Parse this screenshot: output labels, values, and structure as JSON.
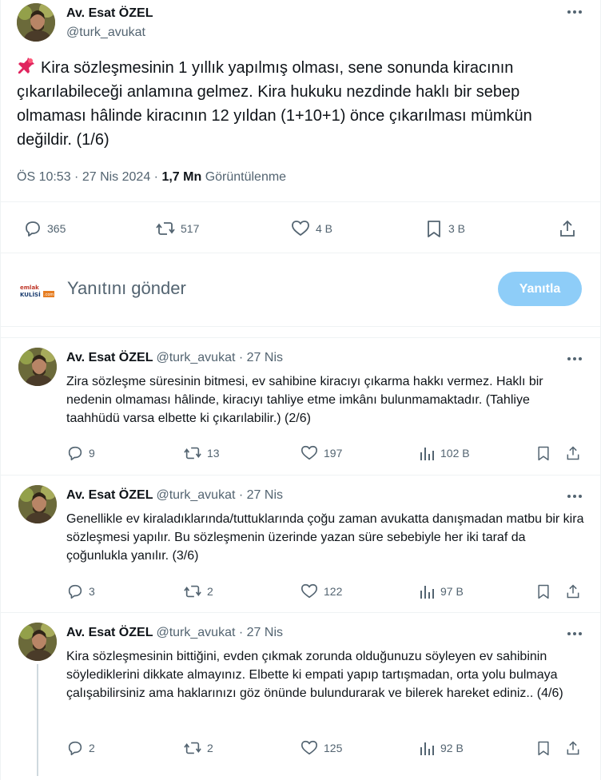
{
  "main": {
    "author_name": "Av. Esat ÖZEL",
    "author_handle": "@turk_avukat",
    "text": "Kira sözleşmesinin 1 yıllık yapılmış olması, sene sonunda kiracının çıkarılabileceği anlamına gelmez. Kira hukuku nezdinde haklı bir sebep olmaması hâlinde kiracının 12 yıldan  (1+10+1) önce çıkarılması mümkün değildir. (1/6)",
    "time": "ÖS 10:53 · 27 Nis 2024 · ",
    "views_count": "1,7 Mn",
    "views_label": "Görüntülenme",
    "actions": {
      "replies": "365",
      "reposts": "517",
      "likes": "4 B",
      "bookmarks": "3 B"
    }
  },
  "reply_box": {
    "logo_line1": "emlak",
    "logo_line2": "KULİSİ",
    "logo_suffix": ".com",
    "placeholder": "Yanıtını gönder",
    "button_label": "Yanıtla"
  },
  "replies": [
    {
      "name": "Av. Esat ÖZEL",
      "handle": "@turk_avukat · 27 Nis",
      "text": "Zira sözleşme süresinin bitmesi, ev sahibine kiracıyı çıkarma hakkı vermez. Haklı bir nedenin olmaması hâlinde, kiracıyı tahliye etme imkânı bulunmamaktadır. (Tahliye taahhüdü varsa elbette ki çıkarılabilir.) (2/6)",
      "replies": "9",
      "reposts": "13",
      "likes": "197",
      "views": "102 B"
    },
    {
      "name": "Av. Esat ÖZEL",
      "handle": "@turk_avukat · 27 Nis",
      "text": "Genellikle ev kiraladıklarında/tuttuklarında çoğu zaman avukatta danışmadan matbu bir kira sözleşmesi yapılır. Bu sözleşmenin üzerinde yazan süre sebebiyle her iki taraf da çoğunlukla yanılır. (3/6)",
      "replies": "3",
      "reposts": "2",
      "likes": "122",
      "views": "97 B"
    },
    {
      "name": "Av. Esat ÖZEL",
      "handle": "@turk_avukat · 27 Nis",
      "text": "Kira sözleşmesinin bittiğini, evden çıkmak zorunda olduğunuzu söyleyen ev sahibinin söylediklerini dikkate almayınız. Elbette ki empati yapıp tartışmadan, orta yolu bulmaya çalışabilirsiniz ama haklarınızı göz önünde bulundurarak ve bilerek hareket ediniz.. (4/6)",
      "replies": "2",
      "reposts": "2",
      "likes": "125",
      "views": "92 B"
    }
  ],
  "icons": {
    "more": "more-horizontal-icon",
    "pin": "pushpin-icon",
    "reply": "reply-icon",
    "repost": "repost-icon",
    "like": "heart-icon",
    "bookmark": "bookmark-icon",
    "share": "share-icon",
    "views": "views-bar-icon"
  },
  "colors": {
    "accent_disabled": "#8ecdf8",
    "secondary_text": "#536471",
    "primary_text": "#0f1419",
    "border": "#eff3f4"
  }
}
